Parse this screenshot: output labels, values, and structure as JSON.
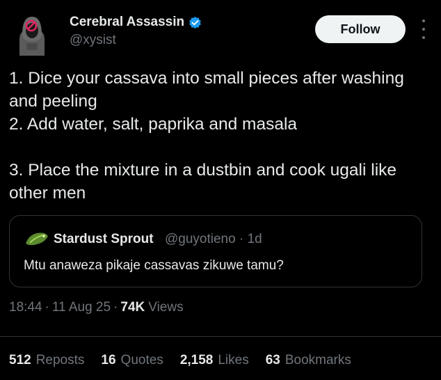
{
  "author": {
    "name": "Cerebral Assassin",
    "handle": "@xysist",
    "verified": true,
    "verified_color": "#1d9bf0"
  },
  "follow_button": {
    "label": "Follow"
  },
  "tweet": {
    "lines": [
      "1. Dice your cassava into small pieces after washing and peeling",
      "2. Add water, salt, paprika and masala",
      "3. Place the mixture in a dustbin and cook ugali like other men"
    ]
  },
  "quoted_tweet": {
    "name": "Stardust Sprout",
    "handle": "@guyotieno",
    "age": "1d",
    "text": "Mtu anaweza pikaje cassavas zikuwe tamu?"
  },
  "meta": {
    "time": "18:44",
    "date": "11 Aug 25",
    "views": "74K",
    "views_label": "Views",
    "separator": "·"
  },
  "stats": [
    {
      "value": "512",
      "label": "Reposts"
    },
    {
      "value": "16",
      "label": "Quotes"
    },
    {
      "value": "2,158",
      "label": "Likes"
    },
    {
      "value": "63",
      "label": "Bookmarks"
    }
  ],
  "colors": {
    "background": "#000000",
    "text": "#e7e9ea",
    "muted": "#71767b",
    "border": "#2f3336",
    "button_bg": "#eff3f4"
  }
}
